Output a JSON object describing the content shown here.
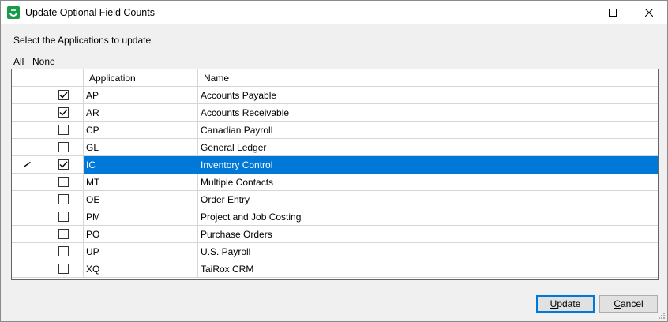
{
  "window": {
    "title": "Update Optional Field Counts",
    "controls": {
      "minimize": "minimize-icon",
      "maximize": "maximize-icon",
      "close": "close-icon"
    }
  },
  "prompt": "Select the Applications to update",
  "selection_links": {
    "all": "All",
    "none": "None"
  },
  "grid": {
    "columns": {
      "application": "Application",
      "name": "Name"
    },
    "rows": [
      {
        "code": "AP",
        "name": "Accounts Payable",
        "checked": true,
        "selected": false
      },
      {
        "code": "AR",
        "name": "Accounts Receivable",
        "checked": true,
        "selected": false
      },
      {
        "code": "CP",
        "name": "Canadian Payroll",
        "checked": false,
        "selected": false
      },
      {
        "code": "GL",
        "name": "General Ledger",
        "checked": false,
        "selected": false
      },
      {
        "code": "IC",
        "name": "Inventory Control",
        "checked": true,
        "selected": true
      },
      {
        "code": "MT",
        "name": "Multiple Contacts",
        "checked": false,
        "selected": false
      },
      {
        "code": "OE",
        "name": "Order Entry",
        "checked": false,
        "selected": false
      },
      {
        "code": "PM",
        "name": "Project and Job Costing",
        "checked": false,
        "selected": false
      },
      {
        "code": "PO",
        "name": "Purchase Orders",
        "checked": false,
        "selected": false
      },
      {
        "code": "UP",
        "name": "U.S. Payroll",
        "checked": false,
        "selected": false
      },
      {
        "code": "XQ",
        "name": "TaiRox CRM",
        "checked": false,
        "selected": false
      }
    ]
  },
  "buttons": {
    "update": {
      "mnemonic": "U",
      "rest": "pdate"
    },
    "cancel": {
      "mnemonic": "C",
      "rest": "ancel"
    }
  },
  "colors": {
    "selection": "#0078d7",
    "app_icon": "#1a9b4b"
  }
}
